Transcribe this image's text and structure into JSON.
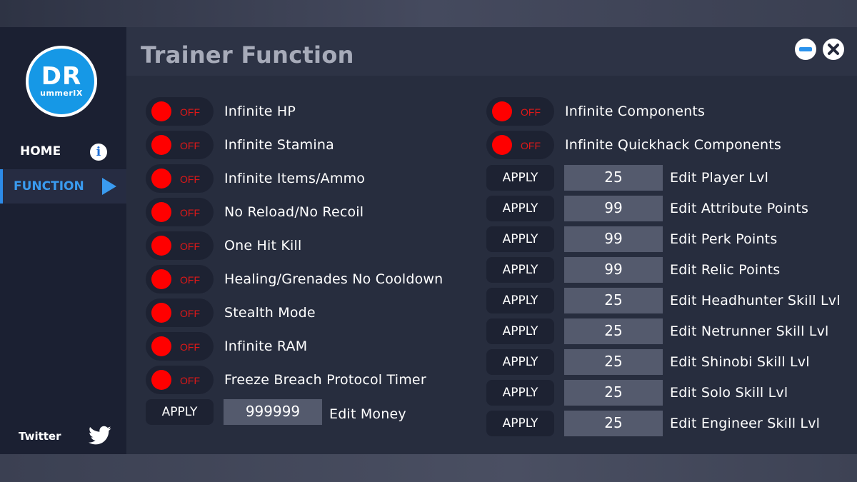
{
  "sidebar": {
    "logo_main": "DR",
    "logo_sub": "ummerIX",
    "nav": [
      {
        "label": "HOME",
        "icon": "info-icon"
      },
      {
        "label": "FUNCTION",
        "icon": "play-icon"
      }
    ],
    "twitter_label": "Twitter",
    "colors": {
      "background": "#1b2032",
      "active": "#3a9bef",
      "logo": "#1698e6"
    }
  },
  "header": {
    "title": "Trainer Function",
    "minimize_icon": "minimize-icon",
    "close_icon": "close-icon"
  },
  "toggles_left": [
    {
      "label": "Infinite HP",
      "state": "OFF"
    },
    {
      "label": "Infinite Stamina",
      "state": "OFF"
    },
    {
      "label": "Infinite Items/Ammo",
      "state": "OFF"
    },
    {
      "label": "No Reload/No Recoil",
      "state": "OFF"
    },
    {
      "label": "One Hit Kill",
      "state": "OFF"
    },
    {
      "label": "Healing/Grenades No Cooldown",
      "state": "OFF"
    },
    {
      "label": "Stealth Mode",
      "state": "OFF"
    },
    {
      "label": "Infinite RAM",
      "state": "OFF"
    },
    {
      "label": "Freeze Breach Protocol Timer",
      "state": "OFF"
    }
  ],
  "money": {
    "button": "APPLY",
    "value": "999999",
    "label": "Edit Money"
  },
  "toggles_right": [
    {
      "label": "Infinite Components",
      "state": "OFF"
    },
    {
      "label": "Infinite Quickhack Components",
      "state": "OFF"
    }
  ],
  "edits_right": [
    {
      "button": "APPLY",
      "value": "25",
      "label": "Edit Player Lvl"
    },
    {
      "button": "APPLY",
      "value": "99",
      "label": "Edit Attribute Points"
    },
    {
      "button": "APPLY",
      "value": "99",
      "label": "Edit Perk Points"
    },
    {
      "button": "APPLY",
      "value": "99",
      "label": "Edit Relic Points"
    },
    {
      "button": "APPLY",
      "value": "25",
      "label": "Edit Headhunter Skill Lvl"
    },
    {
      "button": "APPLY",
      "value": "25",
      "label": "Edit Netrunner Skill Lvl"
    },
    {
      "button": "APPLY",
      "value": "25",
      "label": "Edit Shinobi Skill Lvl"
    },
    {
      "button": "APPLY",
      "value": "25",
      "label": "Edit Solo Skill Lvl"
    },
    {
      "button": "APPLY",
      "value": "25",
      "label": "Edit Engineer Skill Lvl"
    }
  ],
  "colors": {
    "off_indicator": "#ff0000",
    "off_text": "#e01818",
    "panel": "#272d3e",
    "input": "#545a6d"
  }
}
